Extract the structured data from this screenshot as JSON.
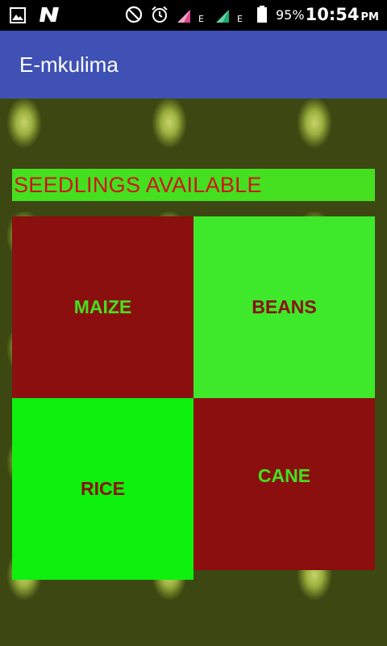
{
  "status_bar": {
    "battery_percent": "95%",
    "time": "10:54",
    "ampm": "PM",
    "network_badges": [
      "E",
      "E"
    ],
    "icons": [
      "gallery-icon",
      "n-app-icon",
      "do-not-disturb-icon",
      "alarm-icon",
      "signal-icon",
      "signal-icon",
      "battery-icon"
    ]
  },
  "app_bar": {
    "title": "E-mkulima",
    "color": "#3f51b5"
  },
  "heading": {
    "text": "SEEDLINGS AVAILABLE",
    "background": "#44e01f",
    "text_color": "#d0131c"
  },
  "tiles": [
    {
      "label": "MAIZE",
      "background": "#8b0f0f",
      "text_color": "#44e01f"
    },
    {
      "label": "BEANS",
      "background": "#3ee82b",
      "text_color": "#8b0f0f"
    },
    {
      "label": "RICE",
      "background": "#0ef00e",
      "text_color": "#8b0f0f"
    },
    {
      "label": "CANE",
      "background": "#8b0f0f",
      "text_color": "#44e01f"
    }
  ]
}
